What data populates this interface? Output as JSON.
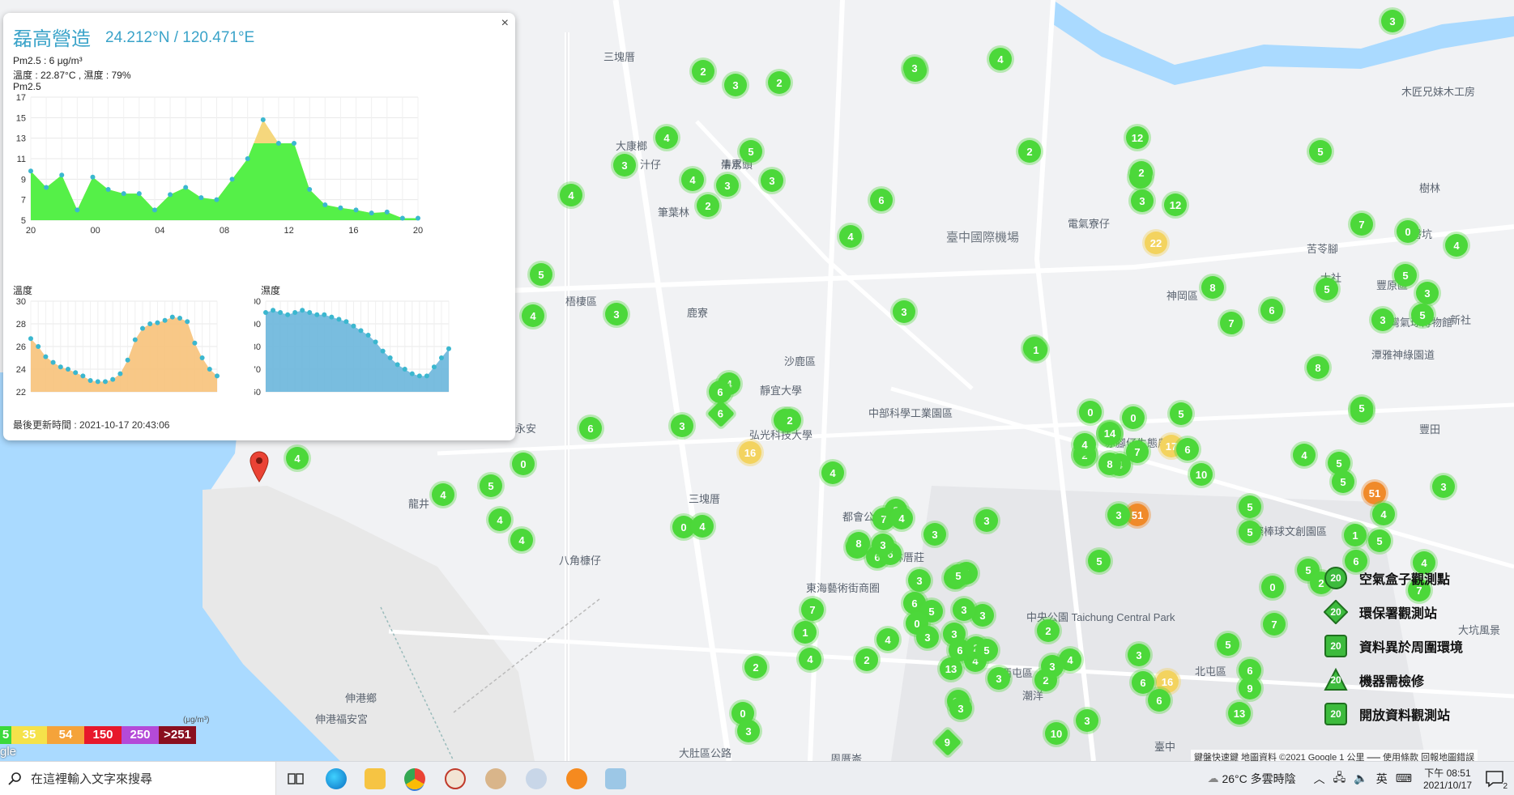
{
  "popup": {
    "title": "磊高營造",
    "coord": "24.212°N / 120.471°E",
    "pm_line": "Pm2.5 : 6 μg/m³",
    "temp_line": "溫度 : 22.87°C , 濕度 : 79%",
    "chart_title": "Pm2.5",
    "temp_label": "溫度",
    "hum_label": "濕度",
    "updated": "最後更新時間 : 2021-10-17 20:43:06",
    "close": "×"
  },
  "chart_data": [
    {
      "type": "area",
      "title": "Pm2.5",
      "x_ticks": [
        "20",
        "00",
        "04",
        "08",
        "12",
        "16",
        "20"
      ],
      "y_ticks": [
        5,
        7,
        9,
        11,
        13,
        15,
        17
      ],
      "ylim": [
        5,
        17
      ],
      "values": [
        9.8,
        8.2,
        9.4,
        6,
        9.2,
        8,
        7.6,
        7.6,
        6,
        7.5,
        8.2,
        7.2,
        7,
        9,
        11,
        14.8,
        12.5,
        12.5,
        8,
        6.5,
        6.2,
        6,
        5.7,
        5.8,
        5.2,
        5.2
      ],
      "ref_line": 12.5,
      "colors": {
        "fill": "#55f048",
        "over": "#f5d77d",
        "point": "#3bb7cf"
      }
    },
    {
      "type": "area",
      "title": "溫度",
      "y_ticks": [
        22,
        24,
        26,
        28,
        30
      ],
      "ylim": [
        22,
        30
      ],
      "values": [
        26.7,
        26,
        25.1,
        24.6,
        24.2,
        24,
        23.7,
        23.4,
        23,
        22.9,
        22.9,
        23.1,
        23.6,
        24.8,
        26.6,
        27.6,
        28,
        28.1,
        28.3,
        28.6,
        28.5,
        28.2,
        26.3,
        25,
        24,
        23.4
      ],
      "colors": {
        "fill": "#f7c27a",
        "point": "#3bb7cf"
      }
    },
    {
      "type": "area",
      "title": "濕度",
      "y_ticks": [
        60,
        70,
        80,
        90,
        100
      ],
      "ylim": [
        60,
        100
      ],
      "values": [
        95,
        96,
        95,
        94,
        95,
        96,
        95,
        94,
        94,
        93,
        92,
        91,
        89,
        87,
        85,
        82,
        78,
        75,
        72,
        70,
        68,
        67,
        67,
        71,
        75,
        79
      ],
      "colors": {
        "fill": "#6ab6dc",
        "point": "#3bb7cf"
      }
    }
  ],
  "scale": [
    {
      "label": "5",
      "color": "#3bd93b"
    },
    {
      "label": "35",
      "color": "#f5e24a"
    },
    {
      "label": "54",
      "color": "#f5a33a"
    },
    {
      "label": "150",
      "color": "#e7182b"
    },
    {
      "label": "250",
      "color": "#b44ad8"
    },
    {
      "label": ">251",
      "color": "#8a0f1f"
    }
  ],
  "scale_unit": "(μg/m³)",
  "google_text": "gle",
  "legend": [
    {
      "label": "空氣盒子觀測點",
      "value": "20",
      "shape": "circle"
    },
    {
      "label": "環保署觀測站",
      "value": "20",
      "shape": "diamond"
    },
    {
      "label": "資料異於周圍環境",
      "value": "20",
      "shape": "square"
    },
    {
      "label": "機器需檢修",
      "value": "20",
      "shape": "triangle"
    },
    {
      "label": "開放資料觀測站",
      "value": "20",
      "shape": "square"
    }
  ],
  "attribution": "鍵盤快速鍵  地圖資料 ©2021 Google  1 公里 ⎯⎯⎯  使用條款  回報地圖錯誤",
  "map_labels": [
    {
      "text": "三塊厝"
    },
    {
      "text": "大康榔"
    },
    {
      "text": "清水"
    },
    {
      "text": "汁仔"
    },
    {
      "text": "牛罵頭"
    },
    {
      "text": "筆葉林"
    },
    {
      "text": "梧棲區"
    },
    {
      "text": "鹿寮"
    },
    {
      "text": "沙鹿區"
    },
    {
      "text": "靜宜大學"
    },
    {
      "text": "弘光科技大學"
    },
    {
      "text": "臺中國際機場"
    },
    {
      "text": "電氣寮仔"
    },
    {
      "text": "神岡區"
    },
    {
      "text": "苦苓腳"
    },
    {
      "text": "大社"
    },
    {
      "text": "豐原區"
    },
    {
      "text": "北磐坑"
    },
    {
      "text": "新社"
    },
    {
      "text": "台灣氣球博物館"
    },
    {
      "text": "潭雅神綠園道"
    },
    {
      "text": "中部科學工業園區"
    },
    {
      "text": "赤腳仔生態農莊"
    },
    {
      "text": "洲際棒球文創園區"
    },
    {
      "text": "龍井"
    },
    {
      "text": "八角槺仔"
    },
    {
      "text": "三塊厝"
    },
    {
      "text": "都會公園"
    },
    {
      "text": "林厝莊"
    },
    {
      "text": "東海藝術街商圈"
    },
    {
      "text": "中央公園 Taichung Central Park"
    },
    {
      "text": "西屯區"
    },
    {
      "text": "臺中"
    },
    {
      "text": "潮洋"
    },
    {
      "text": "伸港鄉"
    },
    {
      "text": "伸港福安宮"
    },
    {
      "text": "大肚區公路"
    },
    {
      "text": "周厝崙"
    },
    {
      "text": "北屯區"
    },
    {
      "text": "永安"
    },
    {
      "text": "木匠兄妹木工房"
    },
    {
      "text": "大坑風景"
    },
    {
      "text": "樹林"
    },
    {
      "text": "豐田"
    }
  ],
  "markers": [
    {
      "v": "2"
    },
    {
      "v": "3"
    },
    {
      "v": "2"
    },
    {
      "v": "3"
    },
    {
      "v": "4"
    },
    {
      "v": "3"
    },
    {
      "v": "4"
    },
    {
      "v": "4"
    },
    {
      "v": "3"
    },
    {
      "v": "3"
    },
    {
      "v": "5"
    },
    {
      "v": "2"
    },
    {
      "v": "3"
    },
    {
      "v": "4"
    },
    {
      "v": "2"
    },
    {
      "v": "2"
    },
    {
      "v": "12"
    },
    {
      "v": "2"
    },
    {
      "v": "3"
    },
    {
      "v": "12"
    },
    {
      "v": "22"
    },
    {
      "v": "5"
    },
    {
      "v": "3"
    },
    {
      "v": "7"
    },
    {
      "v": "0"
    },
    {
      "v": "4"
    },
    {
      "v": "5"
    },
    {
      "v": "3"
    },
    {
      "v": "3"
    },
    {
      "v": "5"
    },
    {
      "v": "8"
    },
    {
      "v": "6"
    },
    {
      "v": "5"
    },
    {
      "v": "7"
    },
    {
      "v": "1"
    },
    {
      "v": "3"
    },
    {
      "v": "4"
    },
    {
      "v": "6"
    },
    {
      "v": "8"
    },
    {
      "v": "5"
    },
    {
      "v": "4"
    },
    {
      "v": "3"
    },
    {
      "v": "14"
    },
    {
      "v": "17"
    },
    {
      "v": "7"
    },
    {
      "v": "2"
    },
    {
      "v": "4"
    },
    {
      "v": "16"
    },
    {
      "v": "5"
    },
    {
      "v": "4"
    },
    {
      "v": "0"
    },
    {
      "v": "4"
    },
    {
      "v": "4"
    },
    {
      "v": "6"
    },
    {
      "v": "4"
    },
    {
      "v": "0"
    },
    {
      "v": "4"
    },
    {
      "v": "5"
    },
    {
      "v": "4"
    },
    {
      "v": "4"
    },
    {
      "v": "3"
    },
    {
      "v": "3"
    },
    {
      "v": "7"
    },
    {
      "v": "8"
    },
    {
      "v": "6"
    },
    {
      "v": "6"
    },
    {
      "v": "5"
    },
    {
      "v": "3"
    },
    {
      "v": "3"
    },
    {
      "v": "1"
    },
    {
      "v": "0"
    },
    {
      "v": "0"
    },
    {
      "v": "14"
    },
    {
      "v": "4"
    },
    {
      "v": "8"
    },
    {
      "v": "6"
    },
    {
      "v": "10"
    },
    {
      "v": "51"
    },
    {
      "v": "3"
    },
    {
      "v": "5"
    },
    {
      "v": "4"
    },
    {
      "v": "5"
    },
    {
      "v": "51"
    },
    {
      "v": "5"
    },
    {
      "v": "4"
    },
    {
      "v": "1"
    },
    {
      "v": "5"
    },
    {
      "v": "3"
    },
    {
      "v": "5"
    },
    {
      "v": "5"
    },
    {
      "v": "0"
    },
    {
      "v": "5"
    },
    {
      "v": "7"
    },
    {
      "v": "5"
    },
    {
      "v": "4"
    },
    {
      "v": "6"
    },
    {
      "v": "7"
    },
    {
      "v": "2"
    },
    {
      "v": "16"
    },
    {
      "v": "5"
    },
    {
      "v": "3"
    },
    {
      "v": "6"
    },
    {
      "v": "3"
    },
    {
      "v": "2"
    },
    {
      "v": "3"
    },
    {
      "v": "2"
    },
    {
      "v": "4"
    },
    {
      "v": "3"
    },
    {
      "v": "13"
    },
    {
      "v": "6"
    },
    {
      "v": "12"
    },
    {
      "v": "2"
    },
    {
      "v": "0"
    },
    {
      "v": "3"
    },
    {
      "v": "10"
    },
    {
      "v": "6"
    },
    {
      "v": "9"
    },
    {
      "v": "13"
    },
    {
      "v": "3"
    },
    {
      "v": "3"
    },
    {
      "v": "6"
    },
    {
      "v": "5"
    },
    {
      "v": "4"
    },
    {
      "v": "0"
    },
    {
      "v": "3"
    },
    {
      "v": "4"
    },
    {
      "v": "3"
    },
    {
      "v": "6"
    },
    {
      "v": "2"
    },
    {
      "v": "5"
    },
    {
      "v": "3"
    },
    {
      "v": "9"
    },
    {
      "v": "4"
    },
    {
      "v": "1"
    },
    {
      "v": "7"
    },
    {
      "v": "0"
    },
    {
      "v": "4"
    },
    {
      "v": "5"
    },
    {
      "v": "3"
    },
    {
      "v": "8"
    },
    {
      "v": "3"
    },
    {
      "v": "4"
    },
    {
      "v": "2"
    },
    {
      "v": "6"
    },
    {
      "v": "5"
    },
    {
      "v": "2"
    },
    {
      "v": "4"
    },
    {
      "v": "3"
    }
  ],
  "taskbar": {
    "search_placeholder": "在這裡輸入文字來搜尋",
    "weather": "26°C 多雲時陰",
    "lang": "英",
    "time": "下午 08:51",
    "date": "2021/10/17",
    "notif_count": "2"
  }
}
